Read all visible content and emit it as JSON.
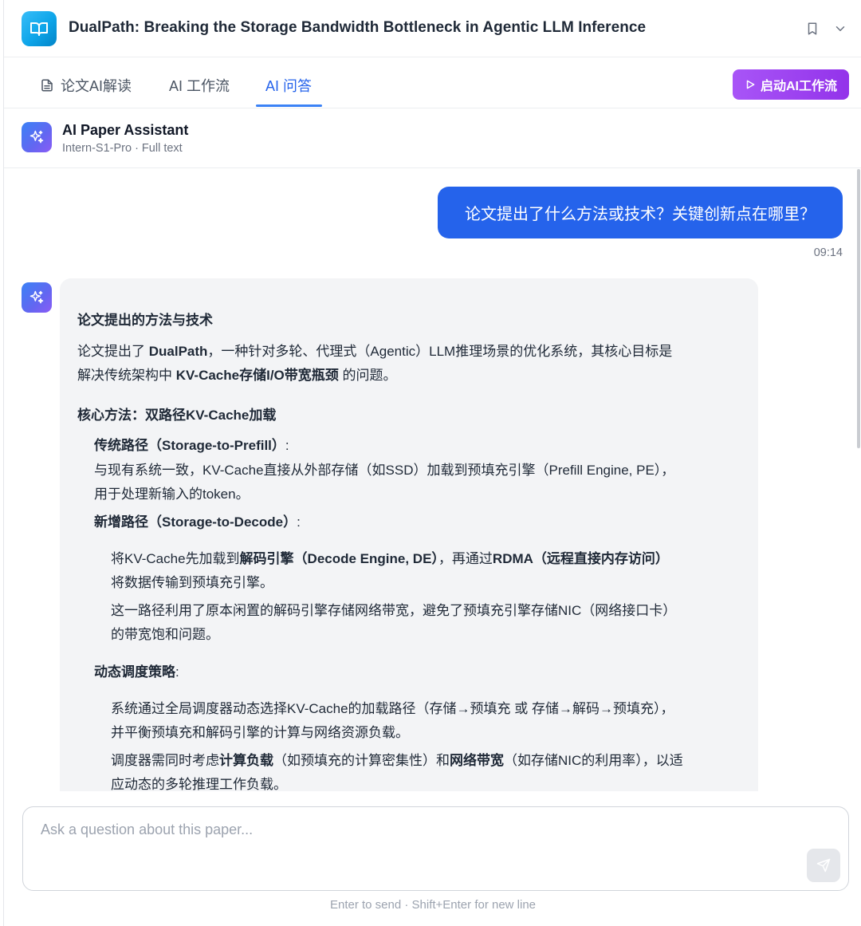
{
  "header": {
    "title": "DualPath: Breaking the Storage Bandwidth Bottleneck in Agentic LLM Inference",
    "icons": [
      "book-open-icon",
      "bookmark-icon",
      "chevron-down-icon"
    ]
  },
  "tabs": [
    {
      "label": "论文AI解读",
      "icon": "document-icon",
      "active": false
    },
    {
      "label": "AI 工作流",
      "active": false
    },
    {
      "label": "AI 问答",
      "active": true
    }
  ],
  "workflow_button": {
    "label": "启动AI工作流",
    "icon": "play-icon"
  },
  "assistant": {
    "name": "AI Paper Assistant",
    "subtitle": "Intern-S1-Pro · Full text",
    "icon": "sparkles-icon"
  },
  "messages": {
    "user": {
      "text": "论文提出了什么方法或技术？关键创新点在哪里？",
      "time": "09:14"
    },
    "ai": {
      "heading": "论文提出的方法与技术",
      "intro": {
        "p1_pre": "论文提出了 ",
        "p1_bold": "DualPath",
        "p1_post": "，一种针对多轮、代理式（Agentic）LLM推理场景的优化系统，其核心目标是",
        "p2_pre": "解决传统架构中 ",
        "p2_bold": "KV-Cache存储I/O带宽瓶颈",
        "p2_post": " 的问题。"
      },
      "core_heading": "核心方法：双路径KV-Cache加载",
      "traditional": {
        "title": "传统路径（Storage-to-Prefill）",
        "colon": ":",
        "line1": "与现有系统一致，KV-Cache直接从外部存储（如SSD）加载到预填充引擎（Prefill Engine, PE），",
        "line2": "用于处理新输入的token。"
      },
      "new_path": {
        "title": "新增路径（Storage-to-Decode）",
        "colon": ":",
        "b1_l1_a": "将KV-Cache先加载到",
        "b1_l1_b": "解码引擎（Decode Engine, DE）",
        "b1_l1_c": "，再通过",
        "b1_l1_d": "RDMA（远程直接内存访问）",
        "b1_l2": "将数据传输到预填充引擎。",
        "b2_l1": "这一路径利用了原本闲置的解码引擎存储网络带宽，避免了预填充引擎存储NIC（网络接口卡）",
        "b2_l2": "的带宽饱和问题。"
      },
      "scheduling": {
        "title": "动态调度策略",
        "colon": ":",
        "b1_l1": "系统通过全局调度器动态选择KV-Cache的加载路径（存储→预填充 或 存储→解码→预填充），",
        "b1_l2": "并平衡预填充和解码引擎的计算与网络资源负载。",
        "b2_l1_a": "调度器需同时考虑",
        "b2_l1_b": "计算负载",
        "b2_l1_c": "（如预填充的计算密集性）和",
        "b2_l1_d": "网络带宽",
        "b2_l1_e": "（如存储NIC的利用率），以适",
        "b2_l2": "应动态的多轮推理工作负载。"
      }
    }
  },
  "input": {
    "placeholder": "Ask a question about this paper...",
    "value": "",
    "send_icon": "send-icon"
  },
  "hint": "Enter to send · Shift+Enter for new line",
  "colors": {
    "primary": "#2563eb",
    "purple": "#9333ea",
    "logo": "#0ea5e9"
  }
}
